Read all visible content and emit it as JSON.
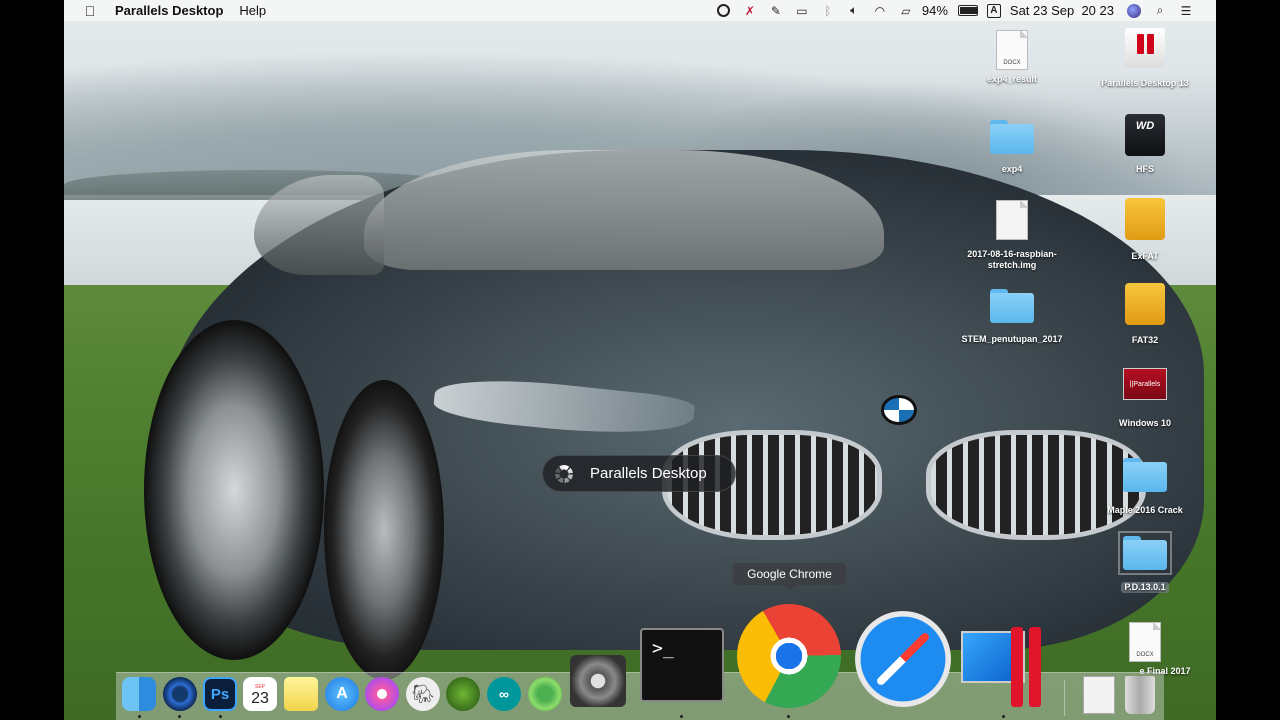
{
  "menubar": {
    "app_name": "Parallels Desktop",
    "menus": [
      "Help"
    ],
    "battery": "94%",
    "input_source": "A",
    "datetime": "Sat 23 Sep  20 23"
  },
  "desktop_icons": [
    {
      "label": "exp4_result",
      "kind": "docx-document",
      "doc_tag": "DOCX"
    },
    {
      "label": "Parallels Desktop 13",
      "kind": "parallels-dmg"
    },
    {
      "label": "exp4",
      "kind": "folder"
    },
    {
      "label": "HFS",
      "kind": "wd-drive",
      "drive_tag": "WD"
    },
    {
      "label": "2017-08-16-raspbian-stretch.img",
      "kind": "disk-image"
    },
    {
      "label": "ExFAT",
      "kind": "external-drive"
    },
    {
      "label": "STEM_penutupan_2017",
      "kind": "folder"
    },
    {
      "label": "FAT32",
      "kind": "external-drive"
    },
    {
      "label": "Windows 10",
      "kind": "parallels-vm",
      "vm_tag": "||Parallels"
    },
    {
      "label": "Maple 2016 Crack",
      "kind": "folder"
    },
    {
      "label": "P.D.13.0.1",
      "kind": "folder"
    },
    {
      "label": "e Final 2017",
      "kind": "docx-document",
      "doc_tag": "DOCX"
    }
  ],
  "loading_indicator": {
    "text": "Parallels Desktop"
  },
  "dock": {
    "tooltip": "Google Chrome",
    "items": [
      {
        "name": "Finder",
        "icon": "finder-icon"
      },
      {
        "name": "QuickTime Player",
        "icon": "quicktime-icon"
      },
      {
        "name": "Photoshop",
        "icon": "photoshop-icon",
        "glyph": "Ps"
      },
      {
        "name": "Calendar",
        "icon": "calendar-icon",
        "month": "SEP",
        "day": "23"
      },
      {
        "name": "Notes",
        "icon": "notes-icon"
      },
      {
        "name": "App Store",
        "icon": "app-store-icon",
        "glyph": "A"
      },
      {
        "name": "iTunes",
        "icon": "itunes-icon"
      },
      {
        "name": "Evernote",
        "icon": "evernote-icon"
      },
      {
        "name": "Globe app",
        "icon": "globe-icon"
      },
      {
        "name": "Arduino",
        "icon": "arduino-icon",
        "glyph": "∞"
      },
      {
        "name": "Atom",
        "icon": "atom-icon"
      },
      {
        "name": "System Preferences",
        "icon": "system-preferences-icon"
      },
      {
        "name": "Terminal",
        "icon": "terminal-icon",
        "glyph": ">_"
      },
      {
        "name": "Google Chrome",
        "icon": "chrome-icon"
      },
      {
        "name": "Safari",
        "icon": "safari-icon"
      },
      {
        "name": "Parallels Desktop",
        "icon": "parallels-icon"
      },
      {
        "name": "Document",
        "icon": "document-icon"
      },
      {
        "name": "Trash",
        "icon": "trash-icon"
      }
    ]
  },
  "colors": {
    "menubar_bg": "#f5f5f5",
    "folder_blue": "#5ab7ec",
    "parallels_red": "#d0021b",
    "chrome_blue": "#1a73e8"
  }
}
